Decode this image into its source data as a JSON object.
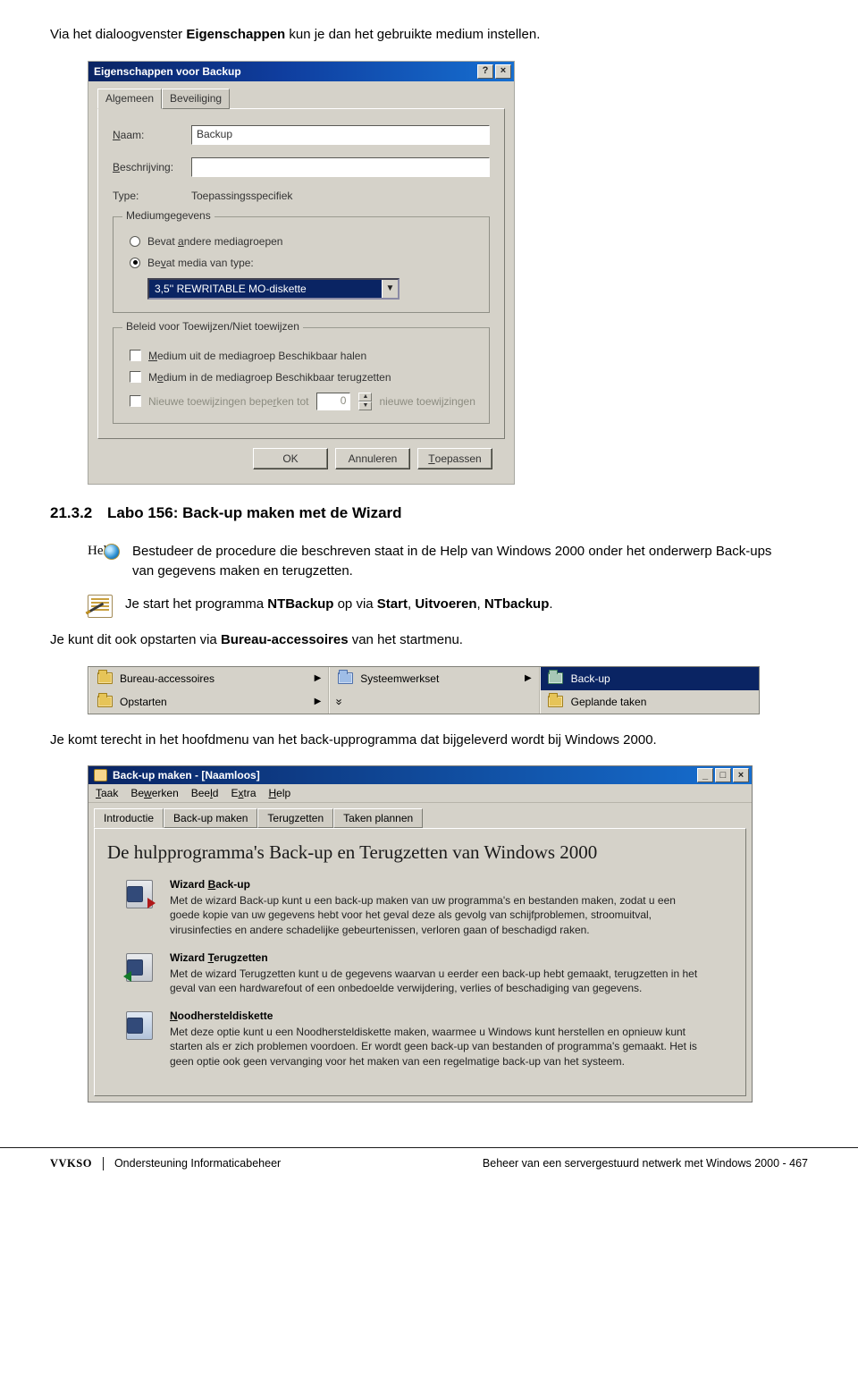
{
  "intro_para": {
    "p1": "Via het dialoogvenster ",
    "b1": "Eigenschappen",
    "p2": " kun je dan het gebruikte medium instellen."
  },
  "section": {
    "num": "21.3.2",
    "title": "Labo 156: Back-up maken met de Wizard"
  },
  "dlg": {
    "title": "Eigenschappen voor Backup",
    "help_btn": "?",
    "close_btn": "×",
    "tabs": {
      "general": "Algemeen",
      "security": "Beveiliging"
    },
    "name_label_u": "N",
    "name_label_rest": "aam:",
    "name_value": "Backup",
    "desc_label_u": "B",
    "desc_label_rest": "eschrijving:",
    "type_label": "Type:",
    "type_value": "Toepassingsspecifiek",
    "group1_legend": "Mediumgegevens",
    "radio1_pre": "Bevat ",
    "radio1_u": "a",
    "radio1_post": "ndere mediagroepen",
    "radio2_pre": "Be",
    "radio2_u": "v",
    "radio2_post": "at media van type:",
    "combo_value": "3,5'' REWRITABLE MO-diskette",
    "group2_legend": "Beleid voor Toewijzen/Niet toewijzen",
    "chk1_u": "M",
    "chk1_rest": "edium uit de mediagroep Beschikbaar halen",
    "chk2_pre": "M",
    "chk2_u": "e",
    "chk2_rest": "dium in de mediagroep Beschikbaar terugzetten",
    "chk3_pre": "Nieuwe toewijzingen bepe",
    "chk3_u": "r",
    "chk3_post": "ken tot",
    "spin_value": "0",
    "spin_suffix": "nieuwe toewijzingen",
    "ok": "OK",
    "cancel": "Annuleren",
    "apply_u": "T",
    "apply_rest": "oepassen"
  },
  "study": {
    "pre": "Bestudeer de procedure die beschreven staat in de Help van Windows 2000 onder het onderwerp Back-ups van gegevens maken en terugzetten."
  },
  "doit": {
    "p1": "Je start het programma ",
    "b1": "NTBackup",
    "p2": " op via ",
    "b2": "Start",
    "c1": ", ",
    "b3": "Uitvoeren",
    "c2": ", ",
    "b4": "NTbackup",
    "p3": "."
  },
  "line3": {
    "p1": "Je kunt dit ook opstarten via ",
    "b1": "Bureau-accessoires",
    "p2": " van het startmenu."
  },
  "menu": {
    "r1c1": "Bureau-accessoires",
    "r1c2": "Systeemwerkset",
    "r1c3": "Back-up",
    "r2c1": "Opstarten",
    "r2c3": "Geplande taken",
    "chevron": "»"
  },
  "line4": "Je komt terecht in het hoofdmenu van het back-upprogramma dat bijgeleverd wordt bij Windows 2000.",
  "app": {
    "title": "Back-up maken - [Naamloos]",
    "menubar": {
      "task_u": "T",
      "task": "aak",
      "edit_pre": "Be",
      "edit_u": "w",
      "edit_post": "erken",
      "view": "Bee",
      "view_u": "l",
      "view_post": "d",
      "extra": "E",
      "extra_u": "x",
      "extra_post": "tra",
      "help_u": "H",
      "help": "elp"
    },
    "tabs": {
      "intro": "Introductie",
      "backup": "Back-up maken",
      "restore": "Terugzetten",
      "plan": "Taken plannen"
    },
    "heading": "De hulpprogramma's Back-up en Terugzetten van Windows 2000",
    "items": [
      {
        "title_pre": "Wizard ",
        "title_u": "B",
        "title_post": "ack-up",
        "desc": "Met de wizard Back-up kunt u een back-up maken van uw programma's en bestanden maken, zodat u een goede kopie van uw gegevens hebt voor het geval deze als gevolg van schijfproblemen, stroomuitval, virusinfecties en andere schadelijke gebeurtenissen, verloren gaan of beschadigd raken."
      },
      {
        "title_pre": "Wizard ",
        "title_u": "T",
        "title_post": "erugzetten",
        "desc": "Met de wizard Terugzetten kunt u de gegevens waarvan u eerder een back-up hebt gemaakt, terugzetten in het geval van een hardwarefout of een onbedoelde verwijdering, verlies of beschadiging van gegevens."
      },
      {
        "title_pre": "",
        "title_u": "N",
        "title_post": "oodhersteldiskette",
        "desc": "Met deze optie kunt u een Noodhersteldiskette maken, waarmee u Windows kunt herstellen en opnieuw kunt starten als er zich problemen voordoen. Er wordt geen back-up van bestanden of programma's gemaakt. Het is geen optie ook geen vervanging voor het maken van een regelmatige back-up van het systeem."
      }
    ]
  },
  "footer": {
    "vvkso": "VVKSO",
    "left": "Ondersteuning Informaticabeheer",
    "right": "Beheer van een servergestuurd netwerk met Windows 2000 -  467"
  }
}
